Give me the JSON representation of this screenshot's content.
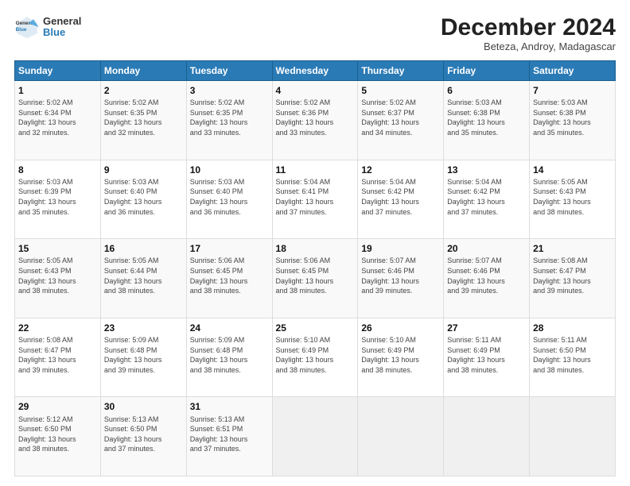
{
  "logo": {
    "general": "General",
    "blue": "Blue"
  },
  "title": "December 2024",
  "location": "Beteza, Androy, Madagascar",
  "days_header": [
    "Sunday",
    "Monday",
    "Tuesday",
    "Wednesday",
    "Thursday",
    "Friday",
    "Saturday"
  ],
  "weeks": [
    [
      {
        "day": "1",
        "info": "Sunrise: 5:02 AM\nSunset: 6:34 PM\nDaylight: 13 hours\nand 32 minutes."
      },
      {
        "day": "2",
        "info": "Sunrise: 5:02 AM\nSunset: 6:35 PM\nDaylight: 13 hours\nand 32 minutes."
      },
      {
        "day": "3",
        "info": "Sunrise: 5:02 AM\nSunset: 6:35 PM\nDaylight: 13 hours\nand 33 minutes."
      },
      {
        "day": "4",
        "info": "Sunrise: 5:02 AM\nSunset: 6:36 PM\nDaylight: 13 hours\nand 33 minutes."
      },
      {
        "day": "5",
        "info": "Sunrise: 5:02 AM\nSunset: 6:37 PM\nDaylight: 13 hours\nand 34 minutes."
      },
      {
        "day": "6",
        "info": "Sunrise: 5:03 AM\nSunset: 6:38 PM\nDaylight: 13 hours\nand 35 minutes."
      },
      {
        "day": "7",
        "info": "Sunrise: 5:03 AM\nSunset: 6:38 PM\nDaylight: 13 hours\nand 35 minutes."
      }
    ],
    [
      {
        "day": "8",
        "info": "Sunrise: 5:03 AM\nSunset: 6:39 PM\nDaylight: 13 hours\nand 35 minutes."
      },
      {
        "day": "9",
        "info": "Sunrise: 5:03 AM\nSunset: 6:40 PM\nDaylight: 13 hours\nand 36 minutes."
      },
      {
        "day": "10",
        "info": "Sunrise: 5:03 AM\nSunset: 6:40 PM\nDaylight: 13 hours\nand 36 minutes."
      },
      {
        "day": "11",
        "info": "Sunrise: 5:04 AM\nSunset: 6:41 PM\nDaylight: 13 hours\nand 37 minutes."
      },
      {
        "day": "12",
        "info": "Sunrise: 5:04 AM\nSunset: 6:42 PM\nDaylight: 13 hours\nand 37 minutes."
      },
      {
        "day": "13",
        "info": "Sunrise: 5:04 AM\nSunset: 6:42 PM\nDaylight: 13 hours\nand 37 minutes."
      },
      {
        "day": "14",
        "info": "Sunrise: 5:05 AM\nSunset: 6:43 PM\nDaylight: 13 hours\nand 38 minutes."
      }
    ],
    [
      {
        "day": "15",
        "info": "Sunrise: 5:05 AM\nSunset: 6:43 PM\nDaylight: 13 hours\nand 38 minutes."
      },
      {
        "day": "16",
        "info": "Sunrise: 5:05 AM\nSunset: 6:44 PM\nDaylight: 13 hours\nand 38 minutes."
      },
      {
        "day": "17",
        "info": "Sunrise: 5:06 AM\nSunset: 6:45 PM\nDaylight: 13 hours\nand 38 minutes."
      },
      {
        "day": "18",
        "info": "Sunrise: 5:06 AM\nSunset: 6:45 PM\nDaylight: 13 hours\nand 38 minutes."
      },
      {
        "day": "19",
        "info": "Sunrise: 5:07 AM\nSunset: 6:46 PM\nDaylight: 13 hours\nand 39 minutes."
      },
      {
        "day": "20",
        "info": "Sunrise: 5:07 AM\nSunset: 6:46 PM\nDaylight: 13 hours\nand 39 minutes."
      },
      {
        "day": "21",
        "info": "Sunrise: 5:08 AM\nSunset: 6:47 PM\nDaylight: 13 hours\nand 39 minutes."
      }
    ],
    [
      {
        "day": "22",
        "info": "Sunrise: 5:08 AM\nSunset: 6:47 PM\nDaylight: 13 hours\nand 39 minutes."
      },
      {
        "day": "23",
        "info": "Sunrise: 5:09 AM\nSunset: 6:48 PM\nDaylight: 13 hours\nand 39 minutes."
      },
      {
        "day": "24",
        "info": "Sunrise: 5:09 AM\nSunset: 6:48 PM\nDaylight: 13 hours\nand 38 minutes."
      },
      {
        "day": "25",
        "info": "Sunrise: 5:10 AM\nSunset: 6:49 PM\nDaylight: 13 hours\nand 38 minutes."
      },
      {
        "day": "26",
        "info": "Sunrise: 5:10 AM\nSunset: 6:49 PM\nDaylight: 13 hours\nand 38 minutes."
      },
      {
        "day": "27",
        "info": "Sunrise: 5:11 AM\nSunset: 6:49 PM\nDaylight: 13 hours\nand 38 minutes."
      },
      {
        "day": "28",
        "info": "Sunrise: 5:11 AM\nSunset: 6:50 PM\nDaylight: 13 hours\nand 38 minutes."
      }
    ],
    [
      {
        "day": "29",
        "info": "Sunrise: 5:12 AM\nSunset: 6:50 PM\nDaylight: 13 hours\nand 38 minutes."
      },
      {
        "day": "30",
        "info": "Sunrise: 5:13 AM\nSunset: 6:50 PM\nDaylight: 13 hours\nand 37 minutes."
      },
      {
        "day": "31",
        "info": "Sunrise: 5:13 AM\nSunset: 6:51 PM\nDaylight: 13 hours\nand 37 minutes."
      },
      {
        "day": "",
        "info": ""
      },
      {
        "day": "",
        "info": ""
      },
      {
        "day": "",
        "info": ""
      },
      {
        "day": "",
        "info": ""
      }
    ]
  ]
}
